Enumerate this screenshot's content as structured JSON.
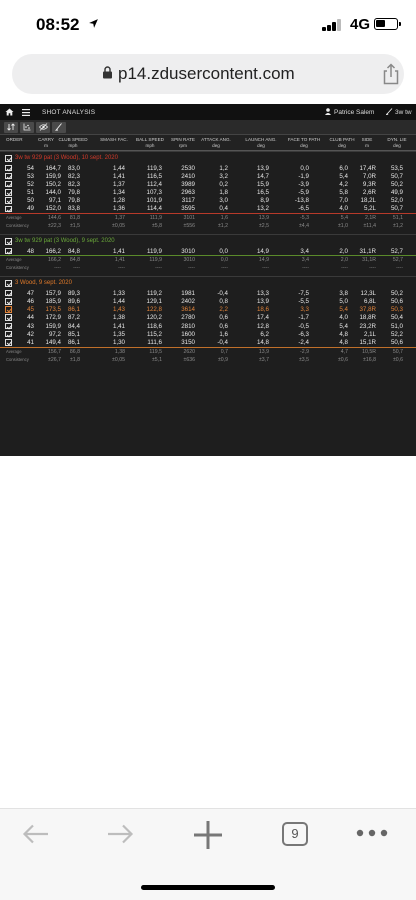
{
  "status": {
    "time": "08:52",
    "network": "4G"
  },
  "browser": {
    "url": "p14.zdusercontent.com",
    "tab_count": "9"
  },
  "app": {
    "title": "SHOT ANALYSIS",
    "user": "Patrice Salem",
    "club": "3w tw",
    "columns": [
      {
        "name": "ORDER",
        "unit": ""
      },
      {
        "name": "CARRY",
        "unit": "m"
      },
      {
        "name": "CLUB SPEED",
        "unit": "mph"
      },
      {
        "name": "SMASH FAC.",
        "unit": ""
      },
      {
        "name": "BALL SPEED",
        "unit": "mph"
      },
      {
        "name": "SPIN RATE",
        "unit": "rpm"
      },
      {
        "name": "ATTACK ANG.",
        "unit": "deg"
      },
      {
        "name": "LAUNCH ANG.",
        "unit": "deg"
      },
      {
        "name": "FACE TO PATH",
        "unit": "deg"
      },
      {
        "name": "CLUB PATH",
        "unit": "deg"
      },
      {
        "name": "SIDE",
        "unit": "m"
      },
      {
        "name": "DYN. LIE",
        "unit": "deg"
      }
    ],
    "groups": [
      {
        "title": "3w tw 929 pat (3 Wood), 10 sept. 2020",
        "color": "#d23a2a",
        "rows": [
          [
            "54",
            "164,7",
            "83,0",
            "1,44",
            "119,3",
            "2530",
            "1,2",
            "13,9",
            "0,0",
            "6,0",
            "17,4R",
            "53,5"
          ],
          [
            "53",
            "159,9",
            "82,3",
            "1,41",
            "116,5",
            "2410",
            "3,2",
            "14,7",
            "-1,9",
            "5,4",
            "7,0R",
            "50,7"
          ],
          [
            "52",
            "150,2",
            "82,3",
            "1,37",
            "112,4",
            "3989",
            "0,2",
            "15,9",
            "-3,9",
            "4,2",
            "9,3R",
            "50,2"
          ],
          [
            "51",
            "144,0",
            "79,8",
            "1,34",
            "107,3",
            "2963",
            "1,8",
            "16,5",
            "-5,9",
            "5,8",
            "2,6R",
            "49,9"
          ],
          [
            "50",
            "97,1",
            "79,8",
            "1,28",
            "101,9",
            "3117",
            "3,0",
            "8,9",
            "-13,8",
            "7,0",
            "18,2L",
            "52,0"
          ],
          [
            "49",
            "152,0",
            "83,8",
            "1,36",
            "114,4",
            "3595",
            "0,4",
            "13,2",
            "-6,5",
            "4,0",
            "5,2L",
            "50,7"
          ]
        ],
        "average": [
          "144,6",
          "81,8",
          "1,37",
          "111,9",
          "3101",
          "1,6",
          "13,9",
          "-5,3",
          "5,4",
          "2,1R",
          "51,1"
        ],
        "consistency": [
          "±22,3",
          "±1,5",
          "±0,05",
          "±5,8",
          "±556",
          "±1,2",
          "±2,5",
          "±4,4",
          "±1,0",
          "±11,4",
          "±1,2"
        ]
      },
      {
        "title": "3w tw 929 pat (3 Wood), 9 sept. 2020",
        "color": "#6aa83a",
        "rows": [
          [
            "48",
            "166,2",
            "84,8",
            "1,41",
            "119,9",
            "3010",
            "0,0",
            "14,9",
            "3,4",
            "2,0",
            "31,1R",
            "52,7"
          ]
        ],
        "average": [
          "166,2",
          "84,8",
          "1,41",
          "119,9",
          "3010",
          "0,0",
          "14,9",
          "3,4",
          "2,0",
          "31,1R",
          "52,7"
        ],
        "consistency": [
          "----",
          "----",
          "----",
          "----",
          "----",
          "----",
          "----",
          "----",
          "----",
          "----",
          "----"
        ]
      },
      {
        "title": "3 Wood, 9 sept. 2020",
        "color": "#e07a2a",
        "rows": [
          [
            "47",
            "157,9",
            "89,3",
            "1,33",
            "119,2",
            "1981",
            "-0,4",
            "13,3",
            "-7,5",
            "3,8",
            "12,3L",
            "50,2"
          ],
          [
            "46",
            "185,9",
            "89,6",
            "1,44",
            "129,1",
            "2402",
            "0,8",
            "13,9",
            "-5,5",
            "5,0",
            "6,8L",
            "50,6"
          ],
          [
            "45",
            "173,5",
            "86,1",
            "1,43",
            "122,8",
            "3614",
            "2,2",
            "18,6",
            "3,3",
            "5,4",
            "37,8R",
            "50,3"
          ],
          [
            "44",
            "172,9",
            "87,2",
            "1,38",
            "120,2",
            "2780",
            "0,6",
            "17,4",
            "-1,7",
            "4,0",
            "18,8R",
            "50,4"
          ],
          [
            "43",
            "159,9",
            "84,4",
            "1,41",
            "118,6",
            "2810",
            "0,6",
            "12,8",
            "-0,5",
            "5,4",
            "23,2R",
            "51,0"
          ],
          [
            "42",
            "97,2",
            "85,1",
            "1,35",
            "115,2",
            "1600",
            "1,6",
            "6,2",
            "-6,3",
            "4,8",
            "2,1L",
            "52,2"
          ],
          [
            "41",
            "149,4",
            "86,1",
            "1,30",
            "111,6",
            "3150",
            "-0,4",
            "14,8",
            "-2,4",
            "4,8",
            "15,1R",
            "50,6"
          ]
        ],
        "highlight_row_index": 2,
        "average": [
          "156,7",
          "86,8",
          "1,38",
          "119,5",
          "2620",
          "0,7",
          "13,9",
          "-2,9",
          "4,7",
          "10,5R",
          "50,7"
        ],
        "consistency": [
          "±26,7",
          "±1,8",
          "±0,05",
          "±5,1",
          "±636",
          "±0,9",
          "±3,7",
          "±3,5",
          "±0,6",
          "±16,8",
          "±0,6"
        ]
      }
    ],
    "average_label": "Average",
    "consistency_label": "Consistency"
  },
  "icons": {
    "location": "location-arrow-icon",
    "lock": "lock-icon",
    "share": "share-icon",
    "home": "home-icon",
    "menu": "hamburger-menu-icon",
    "user": "user-icon",
    "club": "golf-club-icon"
  }
}
